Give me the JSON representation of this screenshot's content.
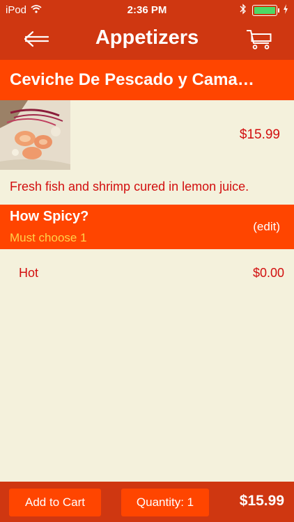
{
  "status_bar": {
    "carrier": "iPod",
    "time": "2:36 PM",
    "icons": [
      "wifi-icon",
      "bluetooth-icon",
      "battery-icon",
      "charging-icon"
    ]
  },
  "nav": {
    "title": "Appetizers",
    "back_icon": "back-arrow-icon",
    "cart_icon": "cart-icon"
  },
  "item": {
    "name": "Ceviche De Pescado y Cama…",
    "price": "$15.99",
    "description": "Fresh fish and shrimp cured in lemon juice."
  },
  "option_group": {
    "title": "How Spicy?",
    "requirement": "Must choose 1",
    "edit_label": "(edit)",
    "choices": [
      {
        "name": "Hot",
        "price": "$0.00"
      }
    ]
  },
  "footer": {
    "add_to_cart_label": "Add to Cart",
    "quantity_label": "Quantity: 1",
    "total": "$15.99"
  },
  "colors": {
    "nav_bar": "#cf3711",
    "header_band": "#ff4500",
    "background": "#f4f1dc",
    "text_red": "#d20f0f",
    "requirement_yellow": "#ffd24a",
    "battery_green": "#4cd964"
  }
}
